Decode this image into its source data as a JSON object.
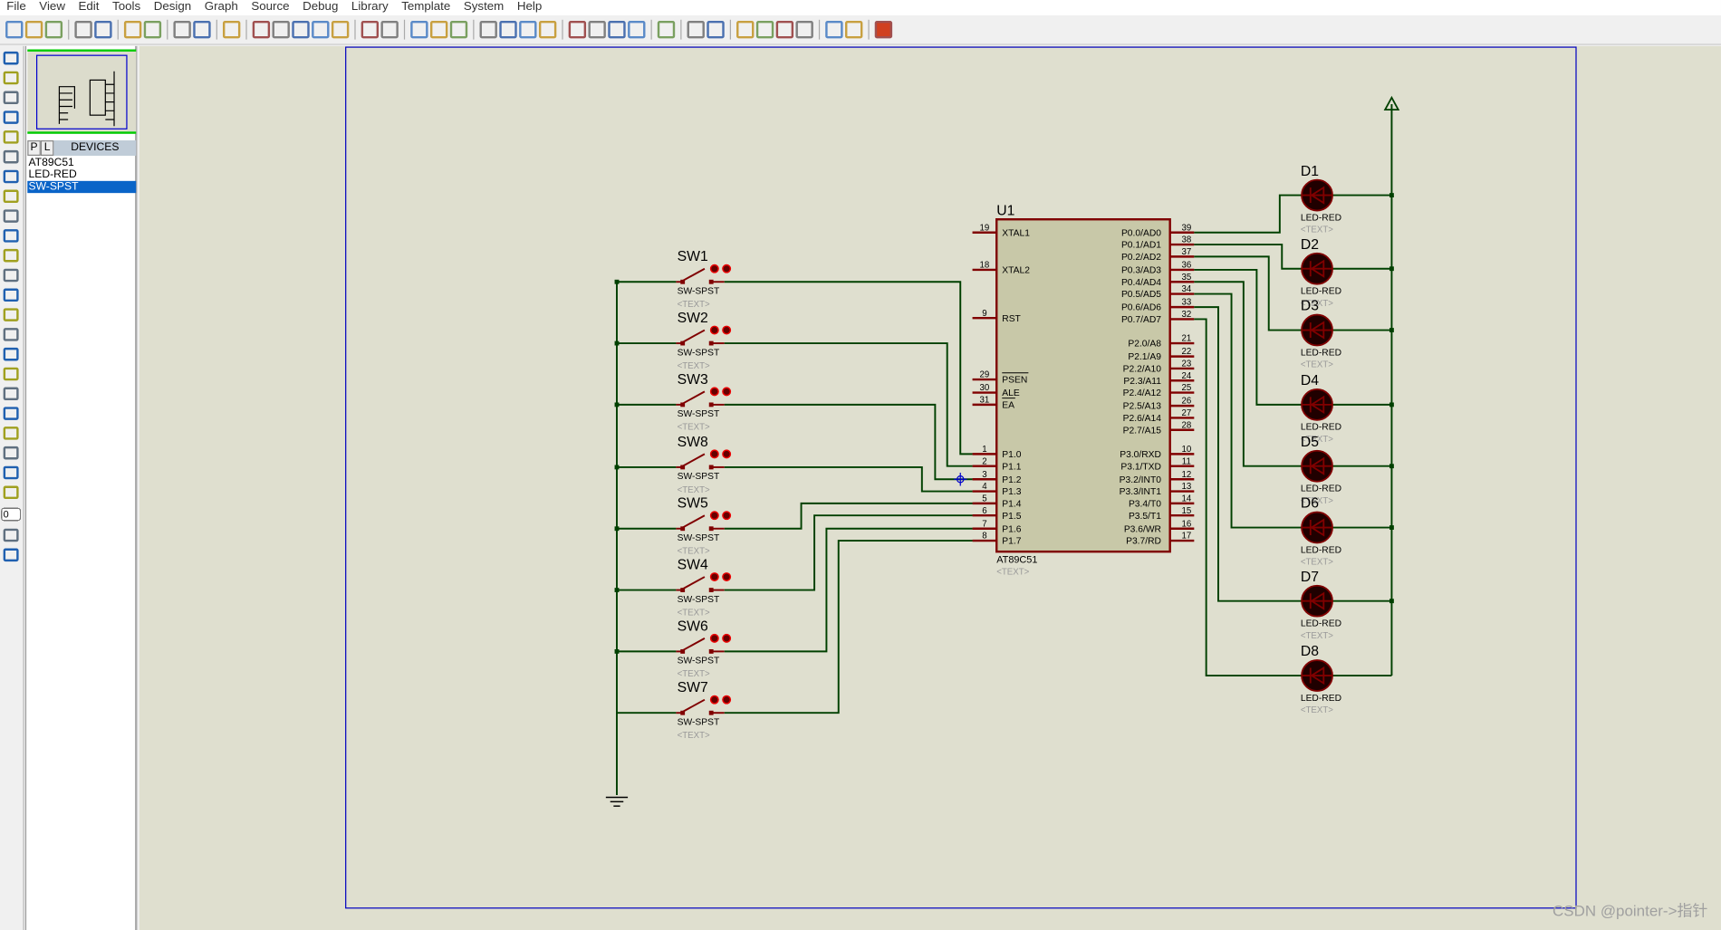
{
  "menu": [
    "File",
    "View",
    "Edit",
    "Tools",
    "Design",
    "Graph",
    "Source",
    "Debug",
    "Library",
    "Template",
    "System",
    "Help"
  ],
  "toolbar_icons": [
    "new-icon",
    "open-icon",
    "save-icon",
    "sep",
    "import-icon",
    "export-icon",
    "sep",
    "print-icon",
    "print-area-icon",
    "sep",
    "refresh-icon",
    "grid-icon",
    "sep",
    "origin-icon",
    "sep",
    "pan-icon",
    "zoom-in-icon",
    "zoom-out-icon",
    "zoom-all-icon",
    "zoom-area-icon",
    "sep",
    "undo-icon",
    "redo-icon",
    "sep",
    "cut-icon",
    "copy-icon",
    "paste-icon",
    "sep",
    "block-copy-icon",
    "block-move-icon",
    "block-rotate-icon",
    "block-delete-icon",
    "sep",
    "pick-device-icon",
    "make-device-icon",
    "packaging-icon",
    "decompose-icon",
    "sep",
    "wire-autorouter-icon",
    "sep",
    "search-icon",
    "property-tool-icon",
    "sep",
    "design-explorer-icon",
    "new-sheet-icon",
    "remove-sheet-icon",
    "exit-parent-icon",
    "sep",
    "bill-of-materials-icon",
    "electrical-rules-icon",
    "sep",
    "ares-icon"
  ],
  "left_tools": [
    "selection-icon",
    "component-icon",
    "junction-icon",
    "label-icon",
    "text-script-icon",
    "bus-icon",
    "subcircuit-icon",
    "terminal-icon",
    "pin-icon",
    "graph-icon",
    "tape-icon",
    "generator-icon",
    "voltage-probe-icon",
    "current-probe-icon",
    "virtual-instrument-icon",
    "line-icon",
    "box-icon",
    "circle-icon",
    "arc-icon",
    "path-icon",
    "text-icon",
    "symbol-icon",
    "marker-icon",
    "rotate-cw-icon",
    "rotate-ccw-icon"
  ],
  "rotation_value": "0",
  "devices": {
    "tab_p": "P",
    "tab_l": "L",
    "title": "DEVICES",
    "items": [
      "AT89C51",
      "LED-RED",
      "SW-SPST"
    ],
    "selected": "SW-SPST"
  },
  "colors": {
    "canvas": "#dfdfcf",
    "wire": "#004000",
    "pin": "#800000",
    "chip": "#c8c8a8",
    "sheet_border": "#0000c0",
    "led": "#200000"
  },
  "chip": {
    "ref": "U1",
    "part": "AT89C51",
    "text": "<TEXT>",
    "left_pins": [
      [
        "19",
        "XTAL1"
      ],
      [
        "18",
        "XTAL2"
      ],
      [
        "9",
        "RST"
      ],
      [
        "29",
        "PSEN"
      ],
      [
        "30",
        "ALE"
      ],
      [
        "31",
        "EA"
      ],
      [
        "1",
        "P1.0"
      ],
      [
        "2",
        "P1.1"
      ],
      [
        "3",
        "P1.2"
      ],
      [
        "4",
        "P1.3"
      ],
      [
        "5",
        "P1.4"
      ],
      [
        "6",
        "P1.5"
      ],
      [
        "7",
        "P1.6"
      ],
      [
        "8",
        "P1.7"
      ]
    ],
    "right_pins": [
      [
        "39",
        "P0.0/AD0"
      ],
      [
        "38",
        "P0.1/AD1"
      ],
      [
        "37",
        "P0.2/AD2"
      ],
      [
        "36",
        "P0.3/AD3"
      ],
      [
        "35",
        "P0.4/AD4"
      ],
      [
        "34",
        "P0.5/AD5"
      ],
      [
        "33",
        "P0.6/AD6"
      ],
      [
        "32",
        "P0.7/AD7"
      ],
      [
        "21",
        "P2.0/A8"
      ],
      [
        "22",
        "P2.1/A9"
      ],
      [
        "23",
        "P2.2/A10"
      ],
      [
        "24",
        "P2.3/A11"
      ],
      [
        "25",
        "P2.4/A12"
      ],
      [
        "26",
        "P2.5/A13"
      ],
      [
        "27",
        "P2.6/A14"
      ],
      [
        "28",
        "P2.7/A15"
      ],
      [
        "10",
        "P3.0/RXD"
      ],
      [
        "11",
        "P3.1/TXD"
      ],
      [
        "12",
        "P3.2/INT0"
      ],
      [
        "13",
        "P3.3/INT1"
      ],
      [
        "14",
        "P3.4/T0"
      ],
      [
        "15",
        "P3.5/T1"
      ],
      [
        "16",
        "P3.6/WR"
      ],
      [
        "17",
        "P3.7/RD"
      ]
    ]
  },
  "switches": [
    {
      "ref": "SW1",
      "part": "SW-SPST",
      "text": "<TEXT>"
    },
    {
      "ref": "SW2",
      "part": "SW-SPST",
      "text": "<TEXT>"
    },
    {
      "ref": "SW3",
      "part": "SW-SPST",
      "text": "<TEXT>"
    },
    {
      "ref": "SW8",
      "part": "SW-SPST",
      "text": "<TEXT>"
    },
    {
      "ref": "SW5",
      "part": "SW-SPST",
      "text": "<TEXT>"
    },
    {
      "ref": "SW4",
      "part": "SW-SPST",
      "text": "<TEXT>"
    },
    {
      "ref": "SW6",
      "part": "SW-SPST",
      "text": "<TEXT>"
    },
    {
      "ref": "SW7",
      "part": "SW-SPST",
      "text": "<TEXT>"
    }
  ],
  "leds": [
    {
      "ref": "D1",
      "part": "LED-RED",
      "text": "<TEXT>"
    },
    {
      "ref": "D2",
      "part": "LED-RED",
      "text": "<TEXT>"
    },
    {
      "ref": "D3",
      "part": "LED-RED",
      "text": "<TEXT>"
    },
    {
      "ref": "D4",
      "part": "LED-RED",
      "text": "<TEXT>"
    },
    {
      "ref": "D5",
      "part": "LED-RED",
      "text": "<TEXT>"
    },
    {
      "ref": "D6",
      "part": "LED-RED",
      "text": "<TEXT>"
    },
    {
      "ref": "D7",
      "part": "LED-RED",
      "text": "<TEXT>"
    },
    {
      "ref": "D8",
      "part": "LED-RED",
      "text": "<TEXT>"
    }
  ],
  "watermark": "CSDN @pointer->指针"
}
